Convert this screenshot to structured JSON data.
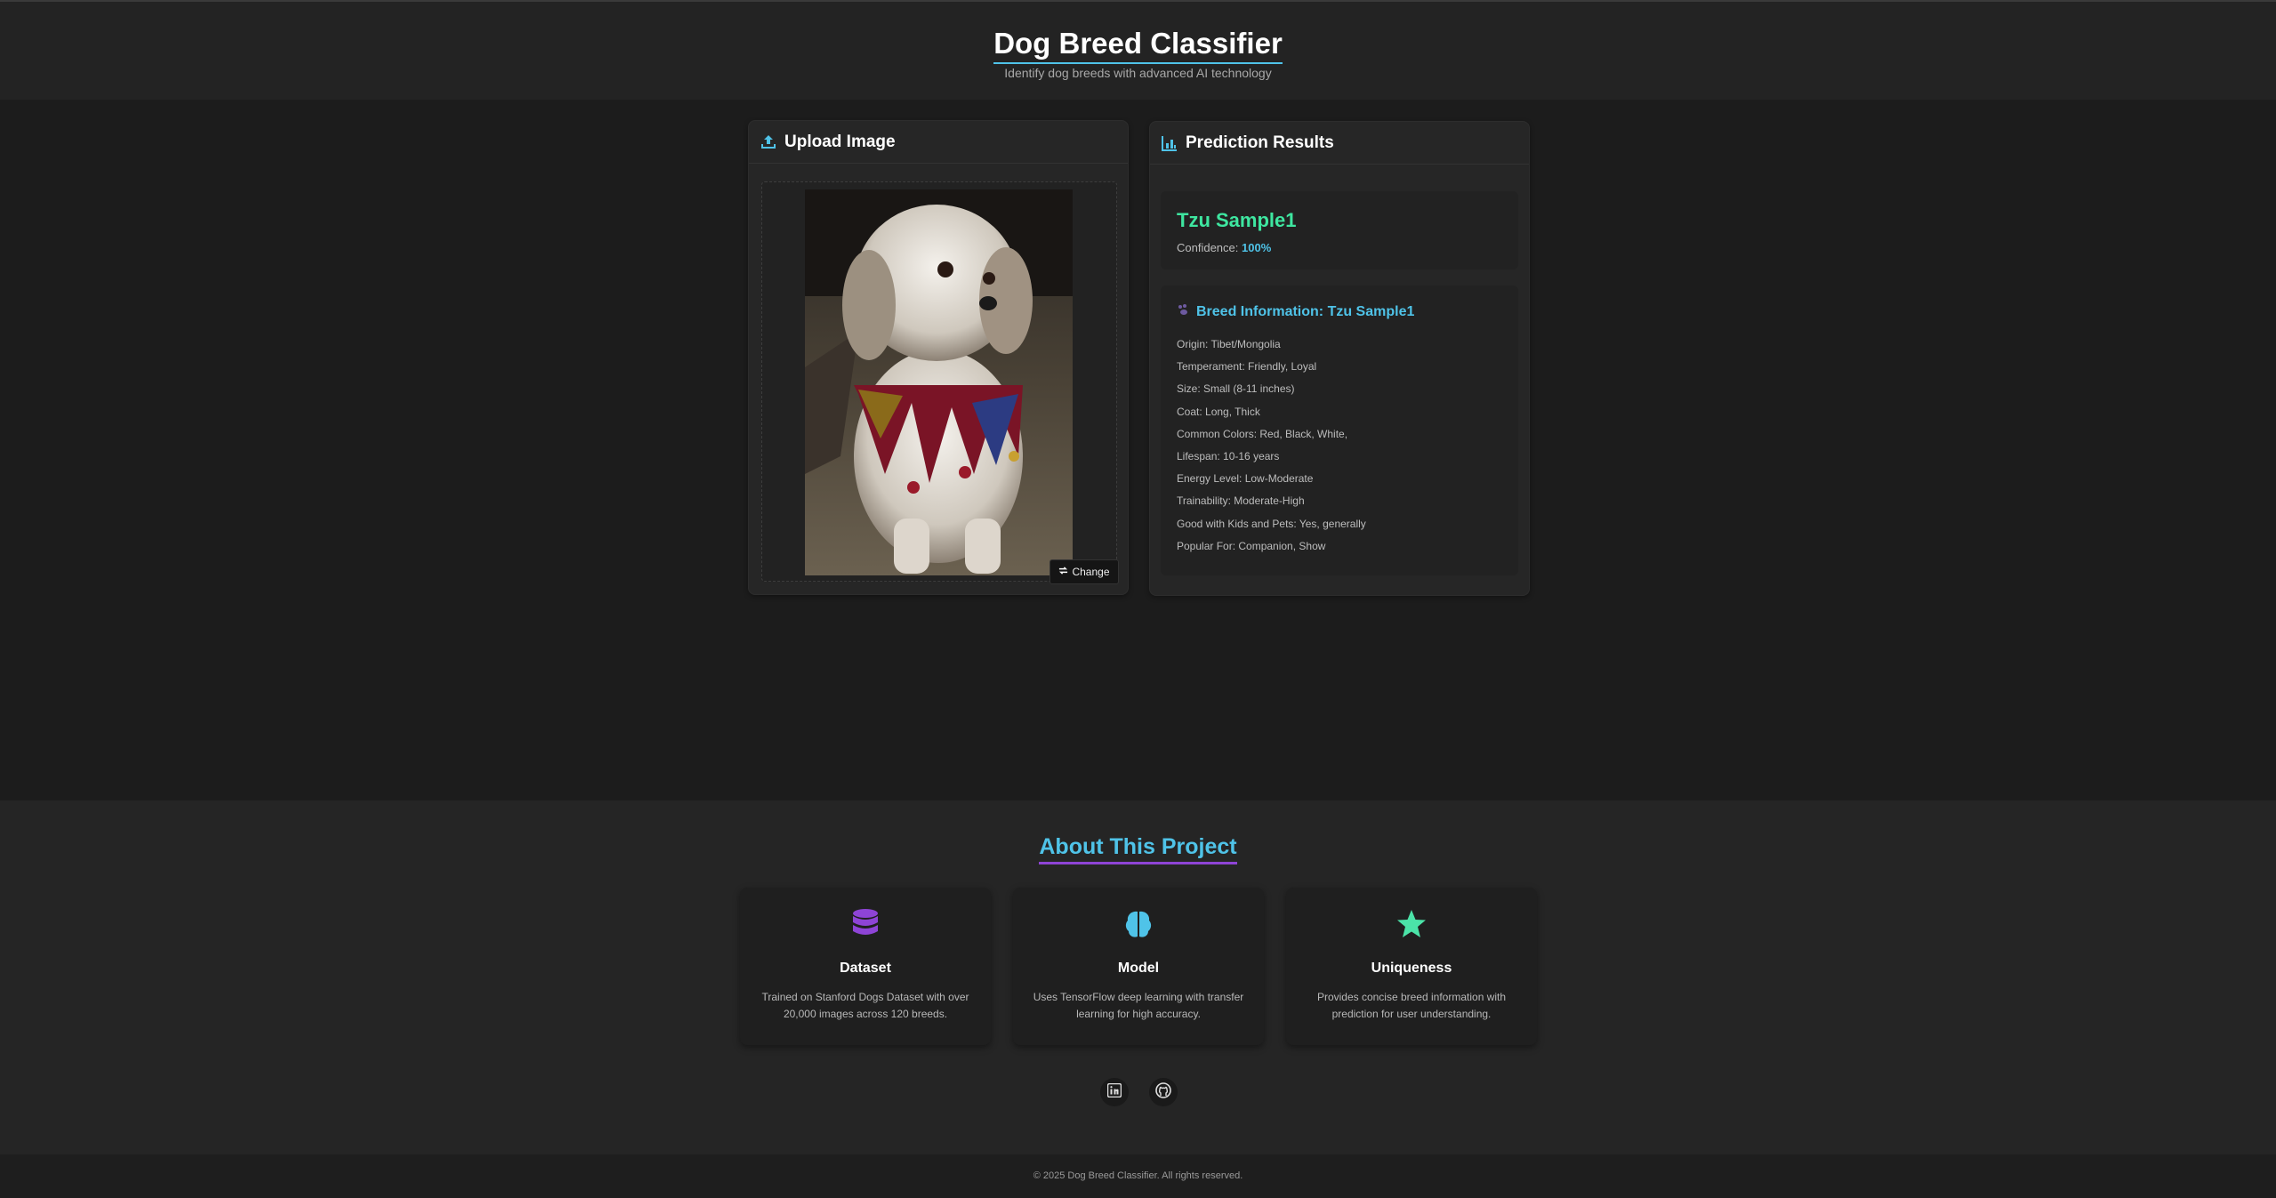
{
  "header": {
    "title": "Dog Breed Classifier",
    "subtitle": "Identify dog breeds with advanced AI technology"
  },
  "upload": {
    "title": "Upload Image",
    "icon": "upload-icon",
    "change_label": "Change",
    "change_icon": "swap-icon"
  },
  "results": {
    "title": "Prediction Results",
    "icon": "chart-icon",
    "breed": "Tzu Sample1",
    "confidence_label": "Confidence:",
    "confidence_value": "100%",
    "info_title": "Breed Information: Tzu Sample1",
    "info_icon": "paw-icon",
    "info": [
      "Origin: Tibet/Mongolia",
      "Temperament: Friendly, Loyal",
      "Size: Small (8-11 inches)",
      "Coat: Long, Thick",
      "Common Colors: Red, Black, White,",
      "Lifespan: 10-16 years",
      "Energy Level: Low-Moderate",
      "Trainability: Moderate-High",
      "Good with Kids and Pets: Yes, generally",
      "Popular For: Companion, Show"
    ]
  },
  "about": {
    "title": "About This Project",
    "features": [
      {
        "icon": "database-icon",
        "title": "Dataset",
        "desc": "Trained on Stanford Dogs Dataset with over 20,000 images across 120 breeds."
      },
      {
        "icon": "brain-icon",
        "title": "Model",
        "desc": "Uses TensorFlow deep learning with transfer learning for high accuracy."
      },
      {
        "icon": "star-icon",
        "title": "Uniqueness",
        "desc": "Provides concise breed information with prediction for user understanding."
      }
    ],
    "social": [
      {
        "icon": "linkedin-icon"
      },
      {
        "icon": "github-icon"
      }
    ]
  },
  "footer": {
    "copyright": "© 2025 Dog Breed Classifier. All rights reserved."
  },
  "colors": {
    "accent": "#4fc3e8",
    "breed": "#3ee6a0",
    "purple": "#8e44d6",
    "green_star": "#4be3a8"
  }
}
